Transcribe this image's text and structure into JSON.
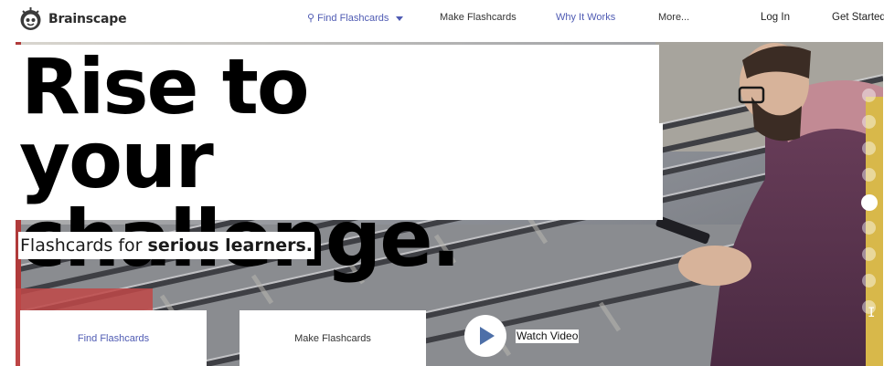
{
  "brand": {
    "name": "Brainscape",
    "logo_icon": "brain-mascot-icon"
  },
  "nav": {
    "find_label": "Find Flashcards",
    "find_icon": "search-icon",
    "make_label": "Make Flashcards",
    "why_label": "Why It Works",
    "more_label": "More...",
    "login_label": "Log In",
    "started_label": "Get Started"
  },
  "hero": {
    "headline_line1": "Rise to",
    "headline_line2": "your challenge.",
    "subhead_plain": "Flashcards for ",
    "subhead_bold": "serious learners.",
    "find_button": "Find Flashcards",
    "make_button": "Make Flashcards",
    "watch_label": "Watch Video",
    "play_icon": "play-icon",
    "slide_count": 9,
    "active_slide": 4
  },
  "colors": {
    "accent": "#4f5bb3",
    "play_triangle": "#4d6fa8",
    "text": "#333333"
  }
}
